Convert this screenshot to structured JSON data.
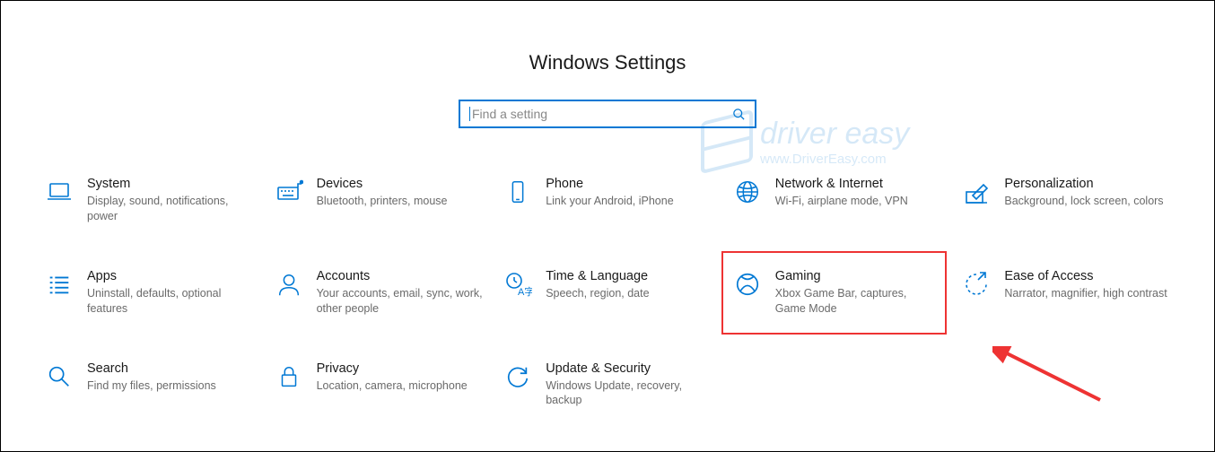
{
  "title": "Windows Settings",
  "search": {
    "placeholder": "Find a setting"
  },
  "watermark": {
    "line1": "driver easy",
    "line2": "www.DriverEasy.com"
  },
  "tiles": [
    {
      "id": "system",
      "icon": "laptop-icon",
      "title": "System",
      "desc": "Display, sound, notifications, power"
    },
    {
      "id": "devices",
      "icon": "keyboard-icon",
      "title": "Devices",
      "desc": "Bluetooth, printers, mouse"
    },
    {
      "id": "phone",
      "icon": "phone-icon",
      "title": "Phone",
      "desc": "Link your Android, iPhone"
    },
    {
      "id": "network",
      "icon": "globe-icon",
      "title": "Network & Internet",
      "desc": "Wi-Fi, airplane mode, VPN"
    },
    {
      "id": "personalization",
      "icon": "pen-icon",
      "title": "Personalization",
      "desc": "Background, lock screen, colors"
    },
    {
      "id": "apps",
      "icon": "apps-icon",
      "title": "Apps",
      "desc": "Uninstall, defaults, optional features"
    },
    {
      "id": "accounts",
      "icon": "person-icon",
      "title": "Accounts",
      "desc": "Your accounts, email, sync, work, other people"
    },
    {
      "id": "time",
      "icon": "time-lang-icon",
      "title": "Time & Language",
      "desc": "Speech, region, date"
    },
    {
      "id": "gaming",
      "icon": "xbox-icon",
      "title": "Gaming",
      "desc": "Xbox Game Bar, captures, Game Mode",
      "highlight": true
    },
    {
      "id": "ease",
      "icon": "ease-icon",
      "title": "Ease of Access",
      "desc": "Narrator, magnifier, high contrast"
    },
    {
      "id": "search",
      "icon": "search-icon",
      "title": "Search",
      "desc": "Find my files, permissions"
    },
    {
      "id": "privacy",
      "icon": "lock-icon",
      "title": "Privacy",
      "desc": "Location, camera, microphone"
    },
    {
      "id": "update",
      "icon": "update-icon",
      "title": "Update & Security",
      "desc": "Windows Update, recovery, backup"
    }
  ]
}
